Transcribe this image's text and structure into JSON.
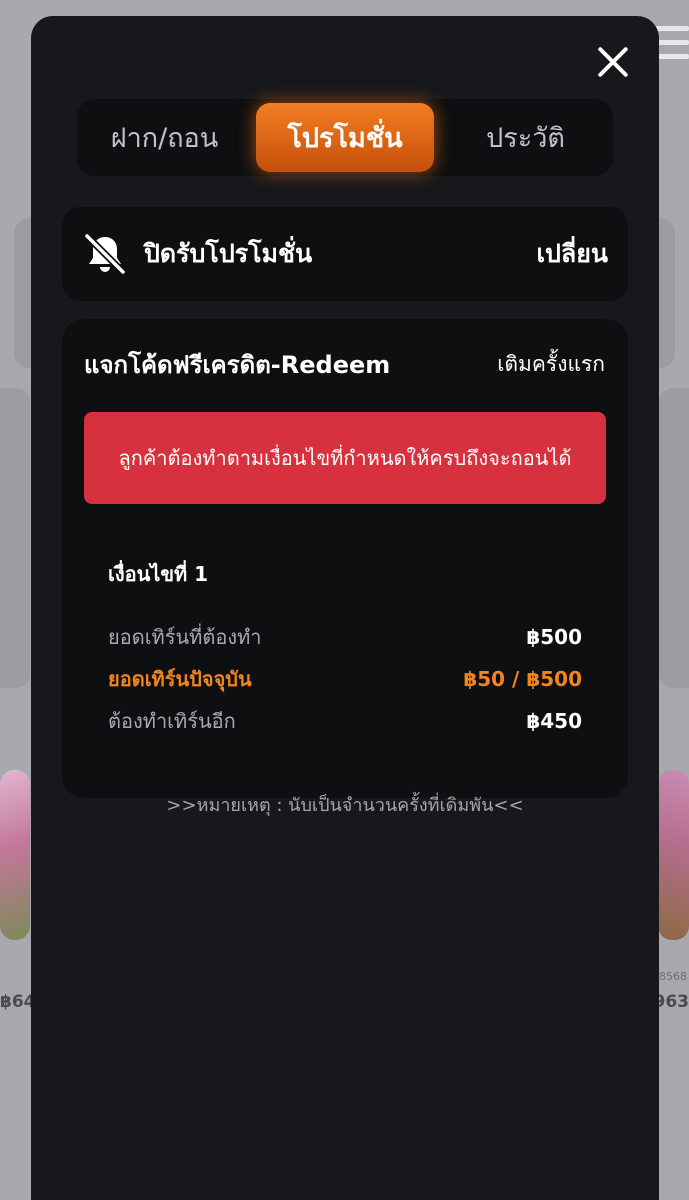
{
  "background": {
    "left_value": "฿64",
    "right_value": ",963",
    "right_sub": "8568"
  },
  "tabs": [
    {
      "label": "ฝาก/ถอน",
      "active": false
    },
    {
      "label": "โปรโมชั่น",
      "active": true
    },
    {
      "label": "ประวัติ",
      "active": false
    }
  ],
  "notification": {
    "icon": "bell-off-icon",
    "label": "ปิดรับโปรโมชั่น",
    "change": "เปลี่ยน"
  },
  "promotion": {
    "title": "แจกโค้ดฟรีเครดิต-Redeem",
    "type": "เติมครั้งแรก",
    "warning": "ลูกค้าต้องทำตามเงื่อนไขที่กำหนดให้ครบถึงจะถอนได้",
    "condition": {
      "heading": "เงื่อนไขที่ 1",
      "rows": [
        {
          "label": "ยอดเทิร์นที่ต้องทำ",
          "value": "฿500"
        },
        {
          "label": "ยอดเทิร์นปัจจุบัน",
          "value": "฿50 / ฿500"
        },
        {
          "label": "ต้องทำเทิร์นอีก",
          "value": "฿450"
        }
      ]
    },
    "note": ">>หมายเหตุ : นับเป็นจำนวนครั้งที่เดิมพัน<<"
  },
  "colors": {
    "accent": "#f08520",
    "warning": "#d7303f",
    "modal_bg": "#17181b",
    "card_bg": "#0e0f11"
  }
}
